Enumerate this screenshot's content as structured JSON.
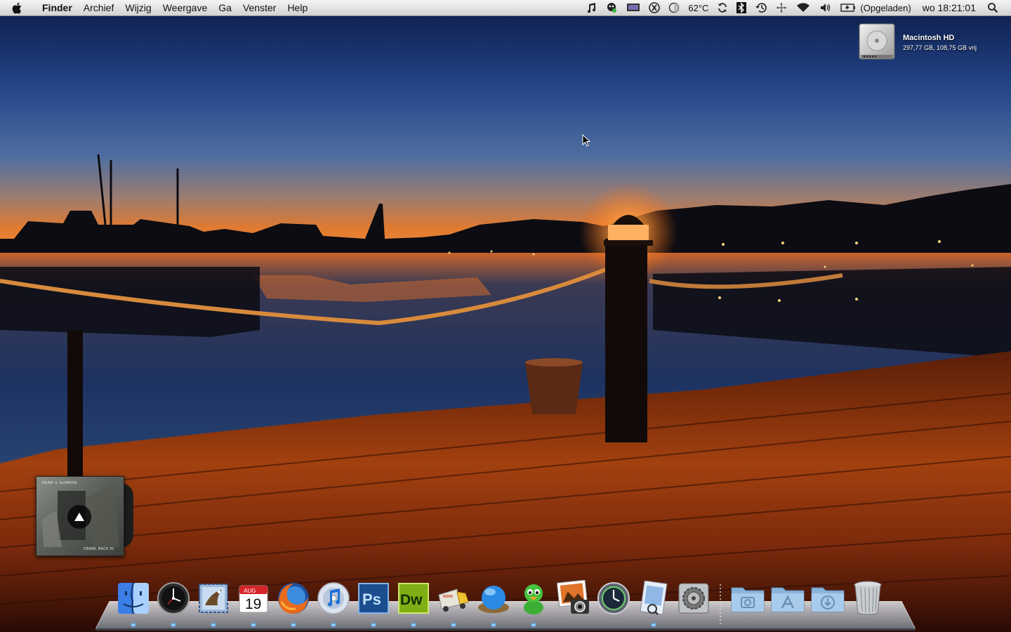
{
  "menubar": {
    "app_name": "Finder",
    "menus": [
      "Archief",
      "Wijzig",
      "Weergave",
      "Ga",
      "Venster",
      "Help"
    ],
    "temperature": "62°C",
    "battery_status": "(Opgeladen)",
    "clock": "wo 18:21:01",
    "status_icons": [
      "music-note-icon",
      "adium-icon",
      "display-icon",
      "x-circle-icon",
      "half-moon-icon",
      "sync-icon",
      "bluetooth-icon",
      "time-machine-icon",
      "move-icon",
      "wifi-icon",
      "volume-icon",
      "battery-icon",
      "spotlight-icon"
    ]
  },
  "desktop": {
    "hd_name": "Macintosh HD",
    "hd_info": "297,77 GB, 108,75 GB vrij"
  },
  "album_widget": {
    "band": "DEAD ☠ SUNRISE",
    "track": "CRAWL BACK IN"
  },
  "calendar_icon": {
    "month": "AUG",
    "day": "19"
  },
  "dock": {
    "apps": [
      "finder-icon",
      "clock-widget-icon",
      "mail-icon",
      "ical-icon",
      "firefox-icon",
      "itunes-icon",
      "photoshop-icon",
      "dreamweaver-icon",
      "transmit-icon",
      "nest-icon",
      "adium-icon",
      "iphoto-icon",
      "time-machine-icon",
      "preview-icon",
      "system-preferences-icon"
    ],
    "stacks": [
      "pictures-stack-icon",
      "applications-stack-icon",
      "downloads-stack-icon",
      "trash-icon"
    ],
    "ps_label": "Ps",
    "dw_label": "Dw"
  },
  "colors": {
    "sky_top": "#0d1e4c",
    "horizon_orange": "#e07a30",
    "deck": "#7a2a0c",
    "running_indicator": "#4aa3ff"
  }
}
